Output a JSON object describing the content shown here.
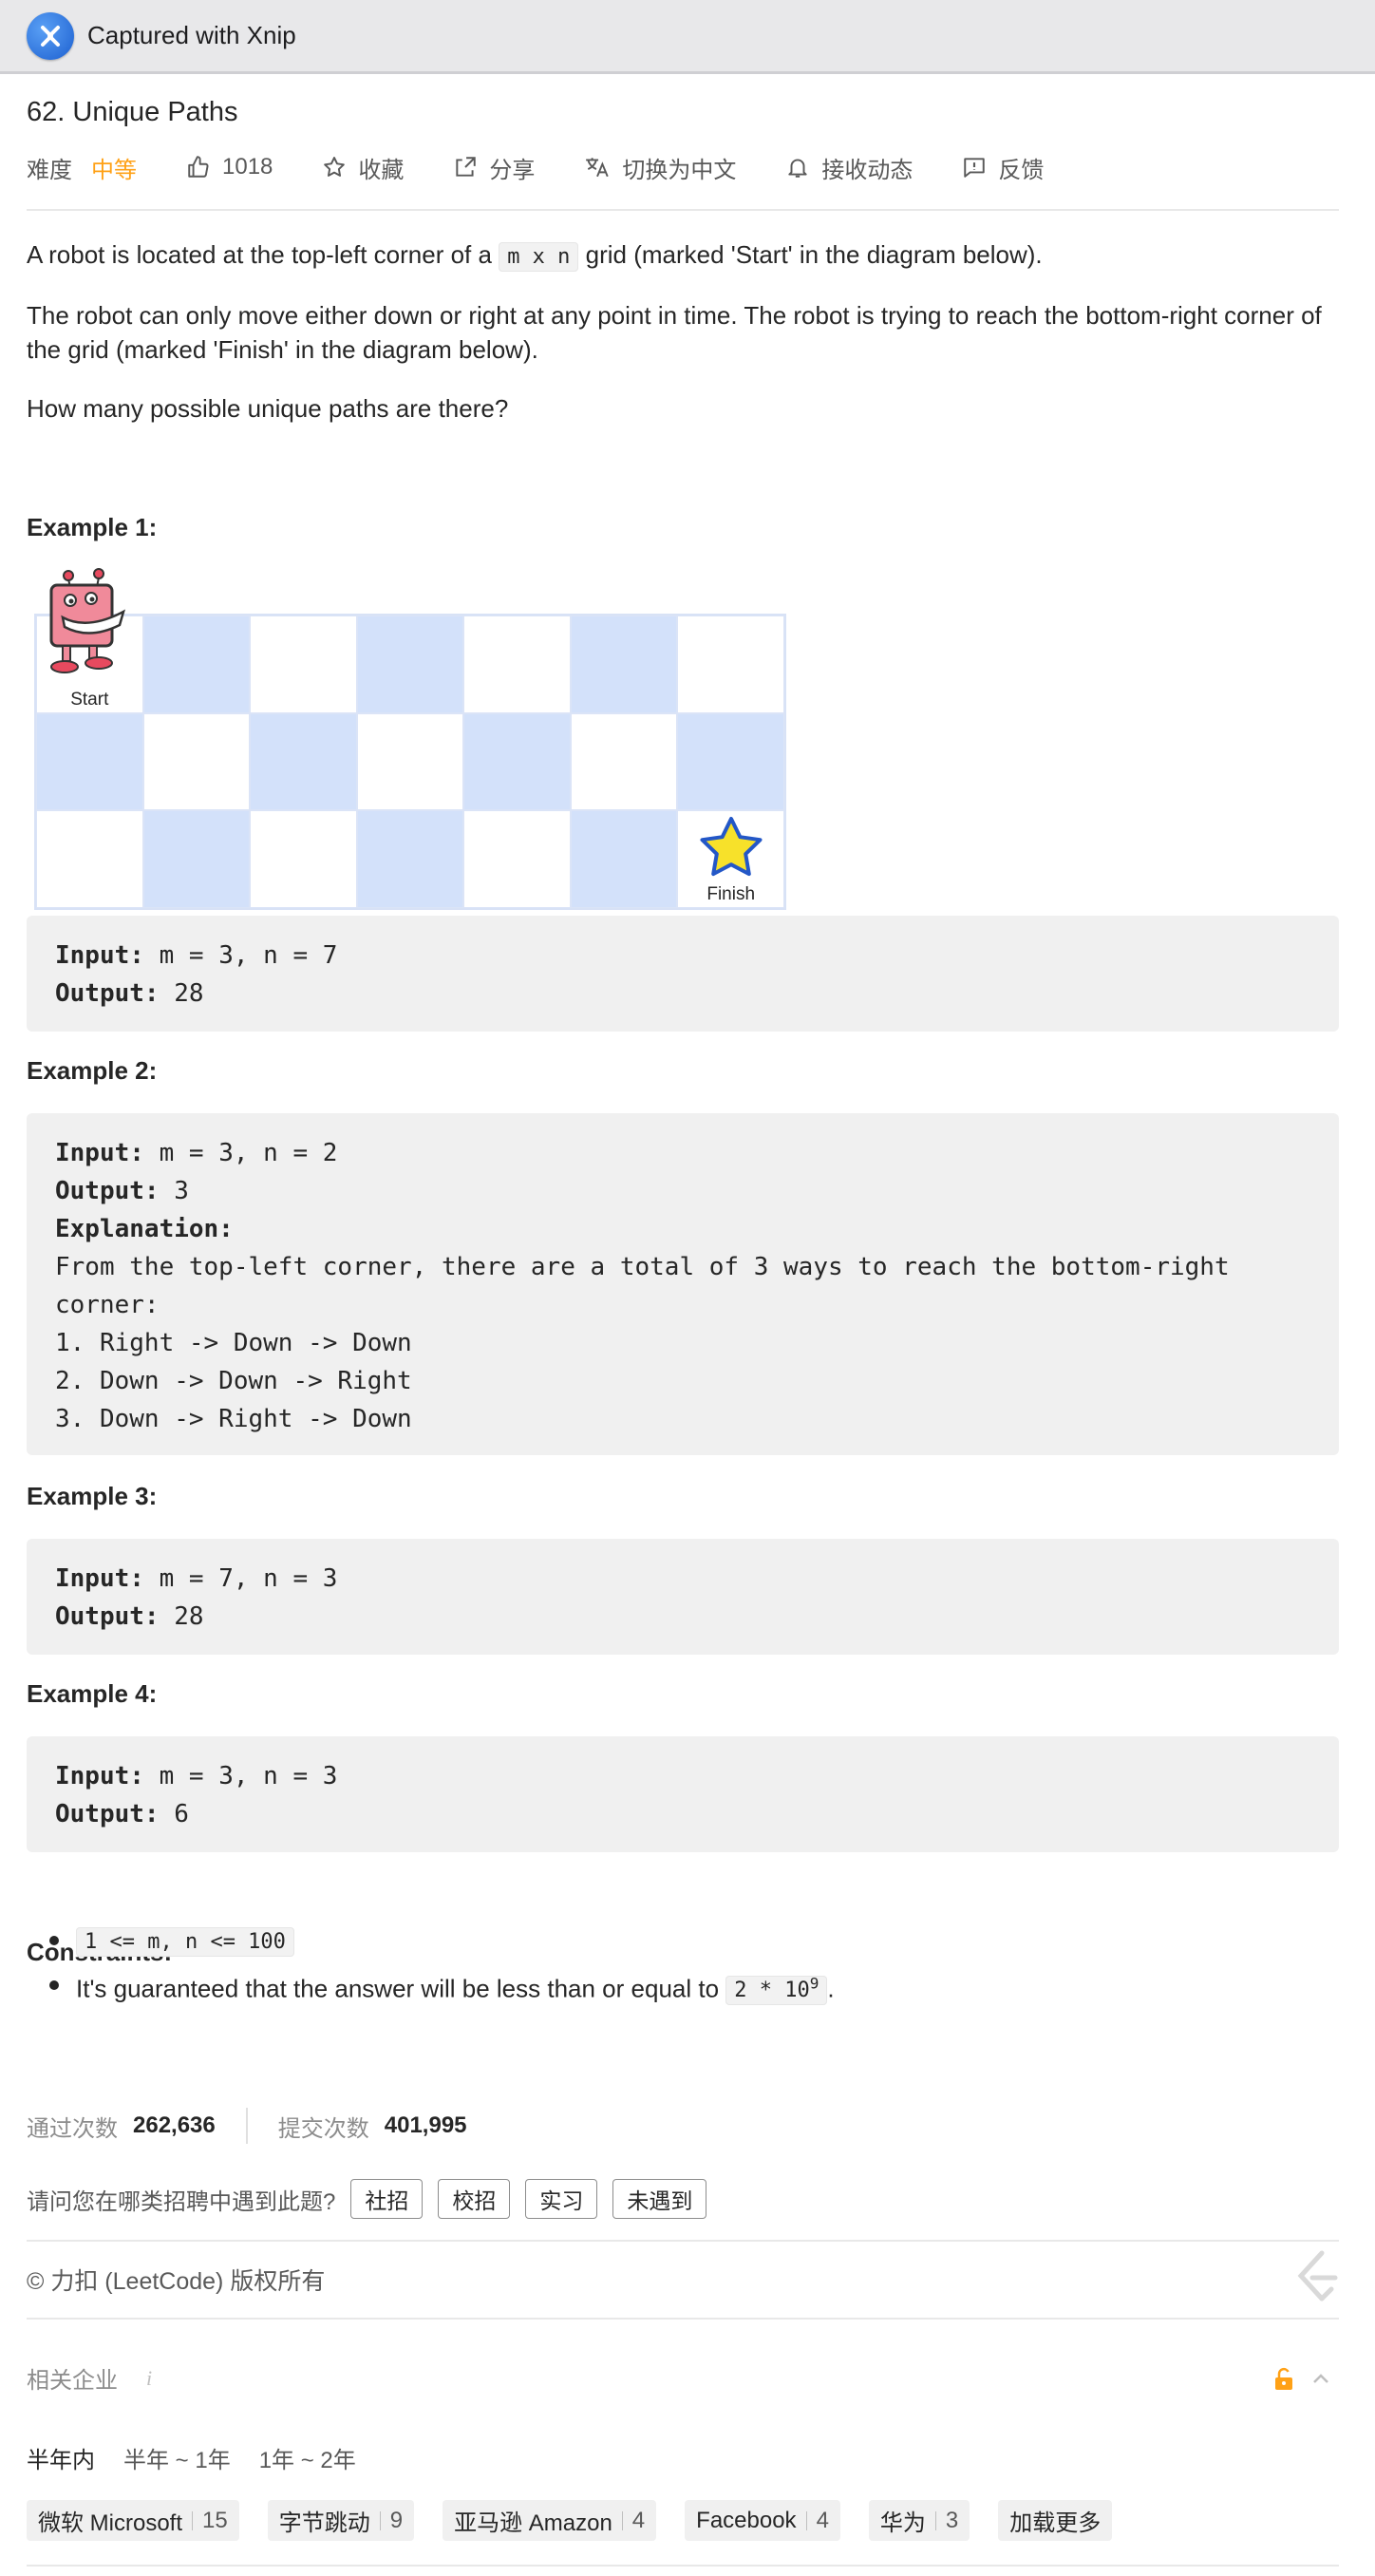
{
  "window": {
    "title": "Captured with Xnip"
  },
  "problem": {
    "title": "62. Unique Paths",
    "difficulty_label": "难度",
    "difficulty": "中等",
    "likes": "1018",
    "favorite": "收藏",
    "share": "分享",
    "switch_lang": "切换为中文",
    "subscribe": "接收动态",
    "feedback": "反馈"
  },
  "description": {
    "p1_pre": "A robot is located at the top-left corner of a ",
    "p1_code": "m x n",
    "p1_post": " grid (marked 'Start' in the diagram below).",
    "p2": "The robot can only move either down or right at any point in time. The robot is trying to reach the bottom-right corner of the grid (marked 'Finish' in the diagram below).",
    "p3": "How many possible unique paths are there?"
  },
  "diagram": {
    "start_label": "Start",
    "finish_label": "Finish"
  },
  "examples": [
    {
      "title": "Example 1:",
      "input_label": "Input:",
      "input": " m = 3, n = 7",
      "output_label": "Output:",
      "output": " 28"
    },
    {
      "title": "Example 2:",
      "input_label": "Input:",
      "input": " m = 3, n = 2",
      "output_label": "Output:",
      "output": " 3",
      "explanation_label": "Explanation:",
      "explanation_lines": [
        "From the top-left corner, there are a total of 3 ways to reach the bottom-right",
        "corner:",
        "1. Right -> Down -> Down",
        "2. Down -> Down -> Right",
        "3. Down -> Right -> Down"
      ]
    },
    {
      "title": "Example 3:",
      "input_label": "Input:",
      "input": " m = 7, n = 3",
      "output_label": "Output:",
      "output": " 28"
    },
    {
      "title": "Example 4:",
      "input_label": "Input:",
      "input": " m = 3, n = 3",
      "output_label": "Output:",
      "output": " 6"
    }
  ],
  "constraints": {
    "title": "Constraints:",
    "c1_code": "1 <= m, n <= 100",
    "c2_pre": "It's guaranteed that the answer will be less than or equal to ",
    "c2_code": "2 * 10",
    "c2_sup": "9",
    "c2_post": "."
  },
  "stats": {
    "accepted_label": "通过次数",
    "accepted": "262,636",
    "submitted_label": "提交次数",
    "submitted": "401,995"
  },
  "recruit": {
    "question": "请问您在哪类招聘中遇到此题?",
    "options": [
      "社招",
      "校招",
      "实习",
      "未遇到"
    ]
  },
  "footer": {
    "copyright": "© 力扣 (LeetCode) 版权所有"
  },
  "companies": {
    "header": "相关企业",
    "info_icon_text": "i",
    "time_filters": [
      "半年内",
      "半年 ~ 1年",
      "1年 ~ 2年"
    ],
    "items": [
      {
        "name": "微软 Microsoft",
        "count": "15"
      },
      {
        "name": "字节跳动",
        "count": "9"
      },
      {
        "name": "亚马逊 Amazon",
        "count": "4"
      },
      {
        "name": "Facebook",
        "count": "4"
      },
      {
        "name": "华为",
        "count": "3"
      }
    ],
    "load_more": "加载更多"
  },
  "colors": {
    "accent": "#ffa116",
    "grid_blue": "#d3e1fa",
    "code_bg": "#f0f0f0"
  }
}
